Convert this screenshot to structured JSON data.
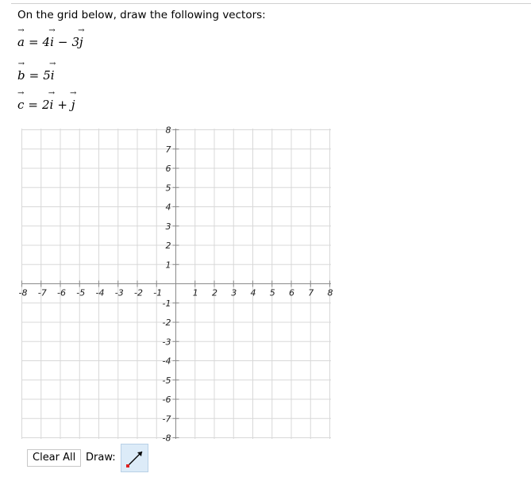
{
  "instruction": "On the grid below, draw the following vectors:",
  "vectors": [
    {
      "name": "a",
      "parts": [
        {
          "coef": "4",
          "unit": "i",
          "sign": ""
        },
        {
          "coef": "3",
          "unit": "j",
          "sign": "−"
        }
      ]
    },
    {
      "name": "b",
      "parts": [
        {
          "coef": "5",
          "unit": "i",
          "sign": ""
        }
      ]
    },
    {
      "name": "c",
      "parts": [
        {
          "coef": "2",
          "unit": "i",
          "sign": ""
        },
        {
          "coef": "",
          "unit": "j",
          "sign": "+"
        }
      ]
    }
  ],
  "graph": {
    "x_range": [
      -8,
      8
    ],
    "y_range": [
      -8,
      8
    ],
    "grid": true,
    "x_tick_labels": [
      "-8",
      "-7",
      "-6",
      "-5",
      "-4",
      "-3",
      "-2",
      "-1",
      "1",
      "2",
      "3",
      "4",
      "5",
      "6",
      "7",
      "8"
    ],
    "y_tick_labels": [
      "8",
      "7",
      "6",
      "5",
      "4",
      "3",
      "2",
      "1",
      "-1",
      "-2",
      "-3",
      "-4",
      "-5",
      "-6",
      "-7",
      "-8"
    ]
  },
  "toolbar": {
    "clear_label": "Clear All",
    "draw_label": "Draw:",
    "draw_tool_icon": "line-segment-icon",
    "draw_tool_color": "#e02020",
    "draw_tool_bg": "#dcebf8"
  }
}
